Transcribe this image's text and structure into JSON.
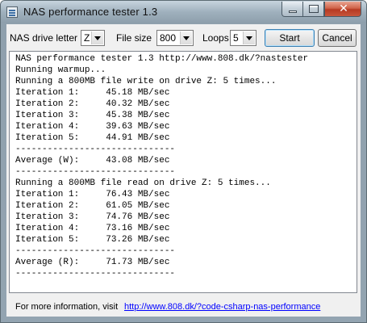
{
  "window": {
    "title": "NAS performance tester 1.3",
    "close_glyph": "✕"
  },
  "toolbar": {
    "drive_label": "NAS drive letter",
    "drive_value": "Z",
    "filesize_label": "File size",
    "filesize_value": "800",
    "loops_label": "Loops",
    "loops_value": "5",
    "start_label": "Start",
    "cancel_label": "Cancel"
  },
  "output_lines": [
    "NAS performance tester 1.3 http://www.808.dk/?nastester",
    "Running warmup...",
    "Running a 800MB file write on drive Z: 5 times...",
    "Iteration 1:     45.18 MB/sec",
    "Iteration 2:     40.32 MB/sec",
    "Iteration 3:     45.38 MB/sec",
    "Iteration 4:     39.63 MB/sec",
    "Iteration 5:     44.91 MB/sec",
    "------------------------------",
    "Average (W):     43.08 MB/sec",
    "------------------------------",
    "Running a 800MB file read on drive Z: 5 times...",
    "Iteration 1:     76.43 MB/sec",
    "Iteration 2:     61.05 MB/sec",
    "Iteration 3:     74.76 MB/sec",
    "Iteration 4:     73.16 MB/sec",
    "Iteration 5:     73.26 MB/sec",
    "------------------------------",
    "Average (R):     71.73 MB/sec",
    "------------------------------"
  ],
  "footer": {
    "text": "For more information, visit",
    "link": "http://www.808.dk/?code-csharp-nas-performance"
  },
  "colors": {
    "link": "#0000ff",
    "close_button": "#c8553b"
  }
}
